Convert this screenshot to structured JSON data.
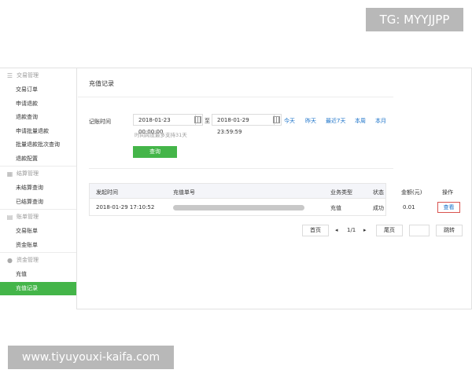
{
  "watermarks": {
    "top": "TG: MYYJJPP",
    "bottom": "www.tiyuyouxi-kaifa.com"
  },
  "sidebar": {
    "groups": [
      {
        "title": "交易管理",
        "icon": "bars-icon",
        "items": [
          "交易订单",
          "申请退款",
          "退款查询",
          "申请批量退款",
          "批量退款批次查询",
          "退款配置"
        ]
      },
      {
        "title": "结算管理",
        "icon": "grid-icon",
        "items": [
          "未结算查询",
          "已结算查询"
        ]
      },
      {
        "title": "账单管理",
        "icon": "bill-icon",
        "items": [
          "交易账单",
          "资金账单"
        ]
      },
      {
        "title": "资金管理",
        "icon": "money-bag-icon",
        "items": [
          "充值",
          "充值记录"
        ]
      }
    ],
    "active": "充值记录"
  },
  "main": {
    "title": "充值记录",
    "filter": {
      "label": "记账时间",
      "start": "2018-01-23 00:00:00",
      "separator": "至",
      "end": "2018-01-29 23:59:59",
      "quick_links": [
        "今天",
        "昨天",
        "最近7天",
        "本周",
        "本月"
      ],
      "hint": "时间跨度最多支持31天",
      "query_button": "查询"
    },
    "table": {
      "headers": [
        "发起时间",
        "充值单号",
        "业务类型",
        "状态",
        "金额(元)",
        "操作"
      ],
      "rows": [
        {
          "time": "2018-01-29 17:10:52",
          "order_no": "",
          "type": "充值",
          "status": "成功",
          "amount": "0.01",
          "action": "查看"
        }
      ]
    },
    "pager": {
      "first": "首页",
      "prev": "◂",
      "info": "1/1",
      "next": "▸",
      "last": "尾页",
      "jump_value": "",
      "jump": "跳转"
    }
  }
}
